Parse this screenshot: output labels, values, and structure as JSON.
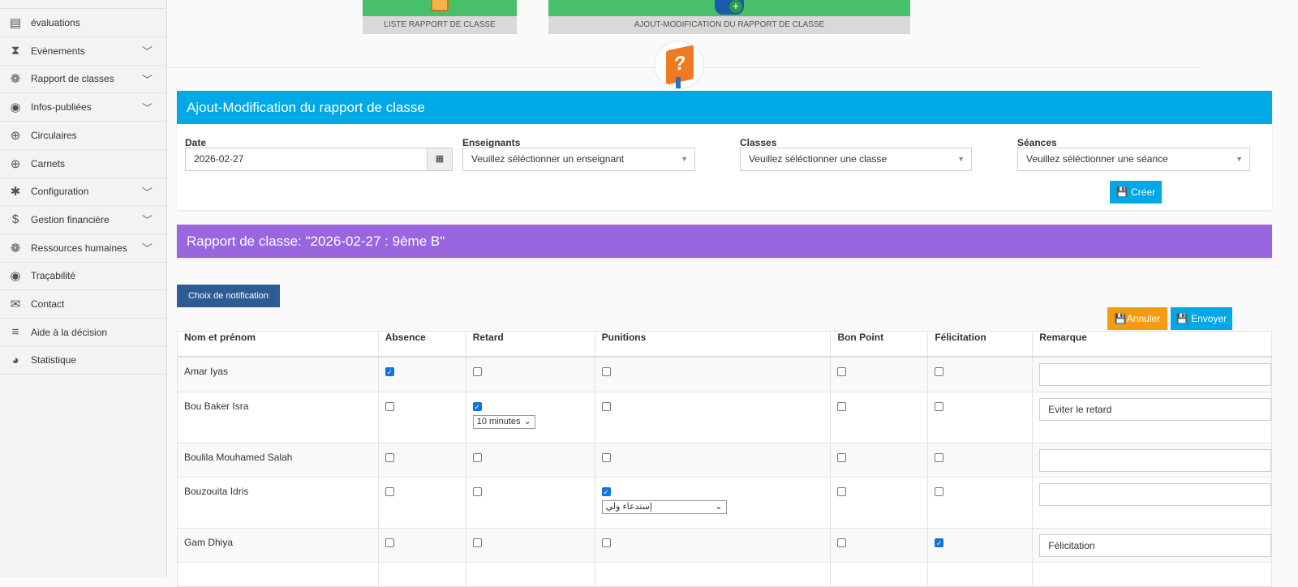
{
  "sidebar": {
    "items": [
      {
        "label": "évaluations",
        "icon": "file-icon",
        "chev": false
      },
      {
        "label": "Evènements",
        "icon": "hourglass-icon",
        "chev": true
      },
      {
        "label": "Rapport de classes",
        "icon": "cubes-icon",
        "chev": true
      },
      {
        "label": "Infos-publiées",
        "icon": "eye-icon",
        "chev": true
      },
      {
        "label": "Circulaires",
        "icon": "crosshairs-icon",
        "chev": false
      },
      {
        "label": "Carnets",
        "icon": "crosshairs-icon",
        "chev": false
      },
      {
        "label": "Configuration",
        "icon": "gear-icon",
        "chev": true
      },
      {
        "label": "Gestion financière",
        "icon": "dollar-icon",
        "chev": true
      },
      {
        "label": "Ressources humaines",
        "icon": "cubes-icon",
        "chev": true
      },
      {
        "label": "Traçabilité",
        "icon": "eye-icon",
        "chev": false
      },
      {
        "label": "Contact",
        "icon": "envelope-icon",
        "chev": false
      },
      {
        "label": "Aide à la décision",
        "icon": "chart-icon",
        "chev": false
      },
      {
        "label": "Statistique",
        "icon": "pie-chart-icon",
        "chev": false
      }
    ]
  },
  "tiles": {
    "list": "LISTE RAPPORT DE CLASSE",
    "edit": "AJOUT-MODIFICATION DU RAPPORT DE CLASSE"
  },
  "form": {
    "title": "Ajout-Modification du rapport de classe",
    "date_label": "Date",
    "date_value": "2026-02-27",
    "teachers_label": "Enseignants",
    "teachers_value": "Veuillez séléctionner un enseignant",
    "classes_label": "Classes",
    "classes_value": "Veuillez séléctionner une classe",
    "sessions_label": "Séances",
    "sessions_value": "Veuillez séléctionner une séance",
    "create": "Créer"
  },
  "report": {
    "title": "Rapport de classe: \"2026-02-27 : 9ème B\"",
    "notif": "Choix de notification",
    "cancel": "Annuler",
    "send": "Envoyer",
    "headers": [
      "Nom et prénom",
      "Absence",
      "Retard",
      "Punitions",
      "Bon Point",
      "Félicitation",
      "Remarque"
    ],
    "rows": [
      {
        "name": "Amar Iyas",
        "absence": true,
        "retard": false,
        "punition": false,
        "bon": false,
        "felic": false,
        "remark": ""
      },
      {
        "name": "Bou Baker Isra",
        "absence": false,
        "retard": true,
        "retard_value": "10 minutes",
        "punition": false,
        "bon": false,
        "felic": false,
        "remark": "Eviter le retard"
      },
      {
        "name": "Boulila Mouhamed Salah",
        "absence": false,
        "retard": false,
        "punition": false,
        "bon": false,
        "felic": false,
        "remark": ""
      },
      {
        "name": "Bouzouita Idris",
        "absence": false,
        "retard": false,
        "punition": true,
        "punition_value": "إستدعاء ولي",
        "bon": false,
        "felic": false,
        "remark": ""
      },
      {
        "name": "Gam Dhiya",
        "absence": false,
        "retard": false,
        "punition": false,
        "bon": false,
        "felic": true,
        "remark": "Félicitation"
      }
    ]
  },
  "colors": {
    "blue": "#00a8e6",
    "purple": "#9966e0",
    "orange": "#f39c12",
    "green": "#48c06a",
    "navy": "#2e5b93"
  }
}
